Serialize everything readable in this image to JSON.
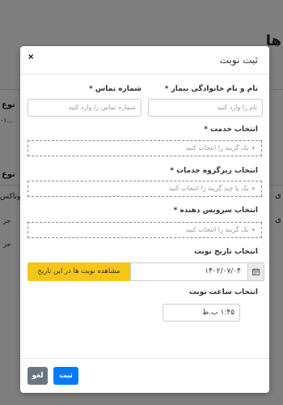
{
  "background": {
    "heading_fragment": "ها",
    "left_col_label_1": "نوع",
    "left_col_value_1": "...۰۱",
    "left_col_label_2": "نوع",
    "left_col_value_2": "وتاکس",
    "left_col_value_3": "جز",
    "left_col_value_4": "جز",
    "right_frag_1": "ی",
    "right_frag_2": "ی"
  },
  "modal": {
    "title": "ثبت نوبت",
    "close_icon": "×",
    "fields": {
      "patient_name": {
        "label": "نام و نام خانوادگی بیمار *",
        "placeholder": "نام را وارد کنید",
        "value": ""
      },
      "phone": {
        "label": "شماره تماس *",
        "placeholder": "شماره تماس را وارد کنید",
        "value": ""
      },
      "service": {
        "label": "انتخاب خدمت *",
        "placeholder": "یک گزینه را انتخاب کنید"
      },
      "service_subgroup": {
        "label": "انتخاب زیرگروه خدمات *",
        "placeholder": "یک یا چند گزینه را انتخاب کنید"
      },
      "provider": {
        "label": "انتخاب سرویس دهنده *",
        "placeholder": "یک گزینه را انتخاب کنید"
      },
      "date": {
        "label": "انتخاب تاریخ نوبت",
        "value": "۱۴۰۲/۰۷/۰۴",
        "button": "مشاهده نوبت ها در این تاریخ",
        "icon": "calendar-icon"
      },
      "time": {
        "label": "انتخاب ساعت نوبت",
        "value": "۱:۴۵ ب.ظ"
      }
    },
    "footer": {
      "submit_label": "ثبت",
      "cancel_label": "لغو"
    }
  },
  "colors": {
    "primary": "#007bff",
    "secondary": "#6c757d",
    "warning": "#f5c518",
    "overlay": "rgba(0,0,0,0.5)"
  }
}
